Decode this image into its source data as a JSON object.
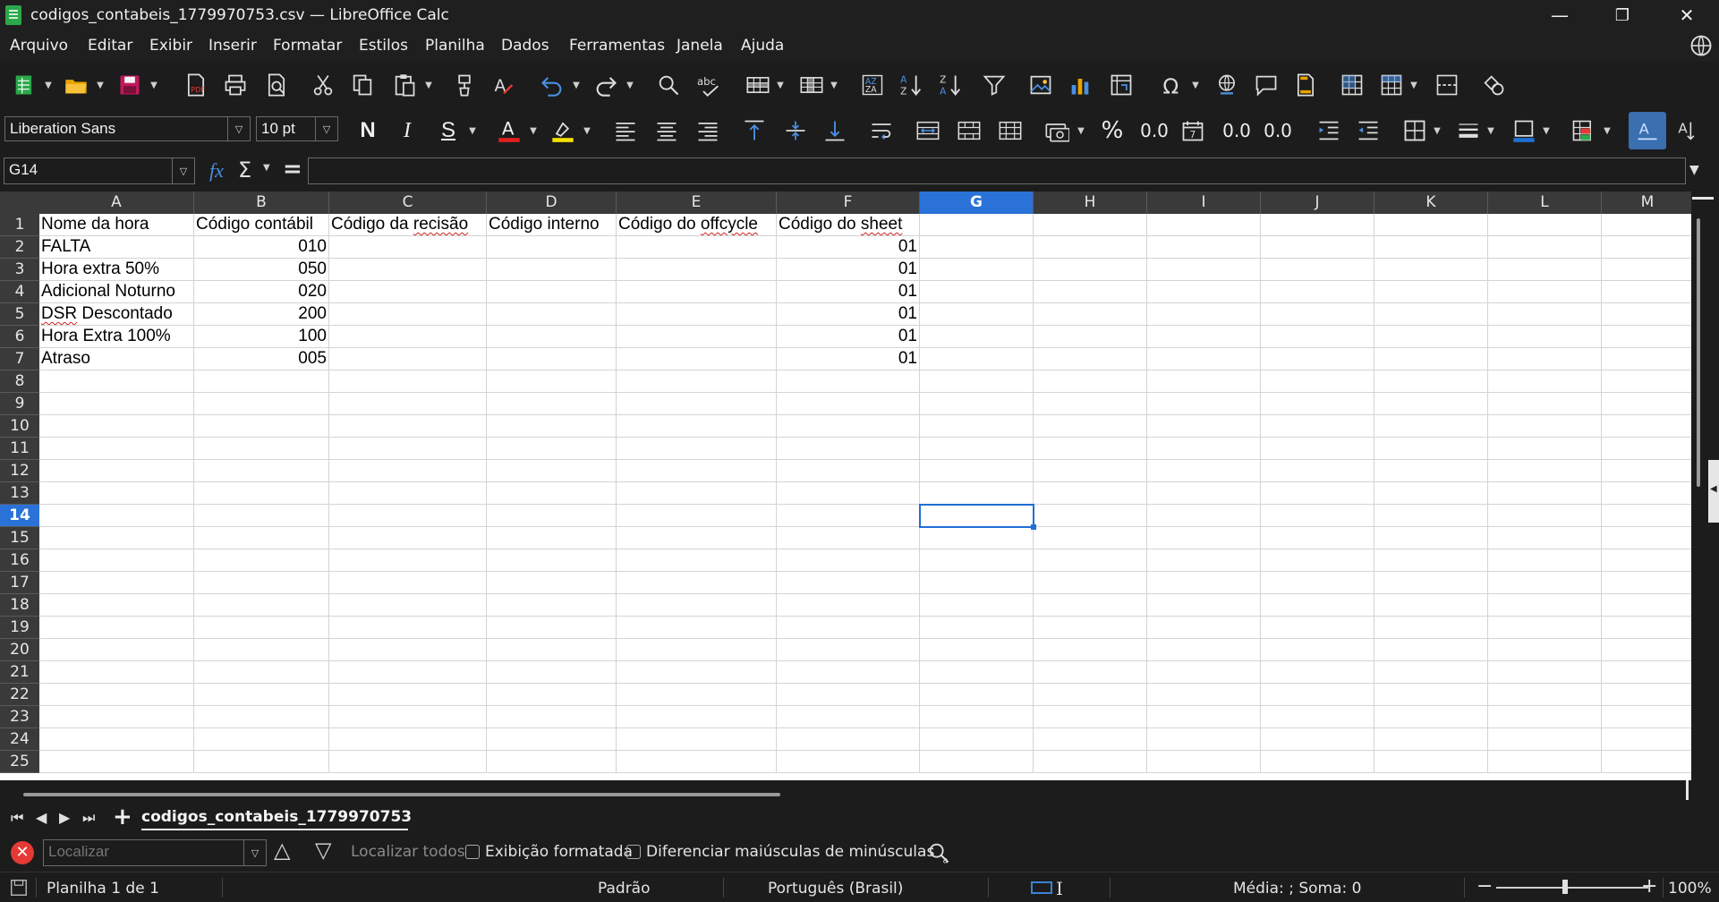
{
  "window": {
    "title": "codigos_contabeis_1779970753.csv — LibreOffice Calc",
    "minimize": "—",
    "restore": "❐",
    "close": "✕"
  },
  "menu": [
    "Arquivo",
    "Editar",
    "Exibir",
    "Inserir",
    "Formatar",
    "Estilos",
    "Planilha",
    "Dados",
    "Ferramentas",
    "Janela",
    "Ajuda"
  ],
  "formatting": {
    "font_name": "Liberation Sans",
    "font_size": "10 pt",
    "bold_label": "N",
    "italic_label": "I",
    "shadow_label": "S",
    "font_color": "#e02020",
    "highlight_color": "#f5e000",
    "percent_label": "%",
    "decimal_label": "0.0",
    "add_decimal_label": "0.0",
    "del_decimal_label": "0.0"
  },
  "formula_bar": {
    "name_box": "G14",
    "fx": "fx",
    "sigma": "Σ",
    "equals": "=",
    "content": ""
  },
  "sheet": {
    "columns": [
      "A",
      "B",
      "C",
      "D",
      "E",
      "F",
      "G",
      "H",
      "I",
      "J",
      "K",
      "L",
      "M"
    ],
    "active_column": "G",
    "active_row": 14,
    "row_count": 25,
    "headers": [
      "Nome da hora",
      "Código contábil",
      "Código da recisão",
      "Código interno",
      "Código do offcycle",
      "Código do sheet"
    ],
    "rows": [
      {
        "nome": "FALTA",
        "codigo": "010",
        "sheet": "01"
      },
      {
        "nome": "Hora extra 50%",
        "codigo": "050",
        "sheet": "01"
      },
      {
        "nome": "Adicional Noturno",
        "codigo": "020",
        "sheet": "01"
      },
      {
        "nome": "DSR Descontado",
        "codigo": "200",
        "sheet": "01"
      },
      {
        "nome": "Hora Extra 100%",
        "codigo": "100",
        "sheet": "01"
      },
      {
        "nome": "Atraso",
        "codigo": "005",
        "sheet": "01"
      }
    ]
  },
  "tabs": {
    "add": "+",
    "sheet_name": "codigos_contabeis_1779970753"
  },
  "find": {
    "placeholder": "Localizar",
    "find_all": "Localizar todos",
    "formatted": "Exibição formatada",
    "match_case": "Diferenciar maiúsculas de minúsculas"
  },
  "status": {
    "sheet": "Planilha 1 de 1",
    "style": "Padrão",
    "language": "Português (Brasil)",
    "summary": "Média: ; Soma: 0",
    "zoom_minus": "−",
    "zoom_plus": "+",
    "zoom": "100%"
  }
}
